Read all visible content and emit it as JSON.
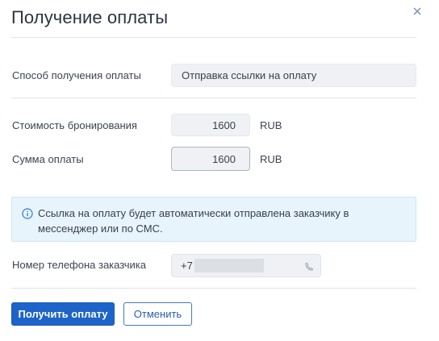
{
  "dialog": {
    "title": "Получение оплаты",
    "close_icon": "close-icon"
  },
  "payment_method": {
    "label": "Способ получения оплаты",
    "value": "Отправка ссылки на оплату"
  },
  "booking_cost": {
    "label": "Стоимость бронирования",
    "value": "1600",
    "currency": "RUB"
  },
  "payment_sum": {
    "label": "Сумма оплаты",
    "value": "1600",
    "currency": "RUB"
  },
  "info": {
    "icon": "info-icon",
    "text": "Ссылка на оплату будет автоматически отправлена заказчику в мессенджер или по СМС."
  },
  "customer_phone": {
    "label": "Номер телефона заказчика",
    "prefix": "+7",
    "icon": "phone-icon"
  },
  "actions": {
    "submit_label": "Получить оплату",
    "cancel_label": "Отменить"
  },
  "colors": {
    "primary": "#1e64c8",
    "info_bg": "#e8f4fc",
    "info_icon": "#2a7bd6",
    "field_bg": "#eff1f4"
  }
}
